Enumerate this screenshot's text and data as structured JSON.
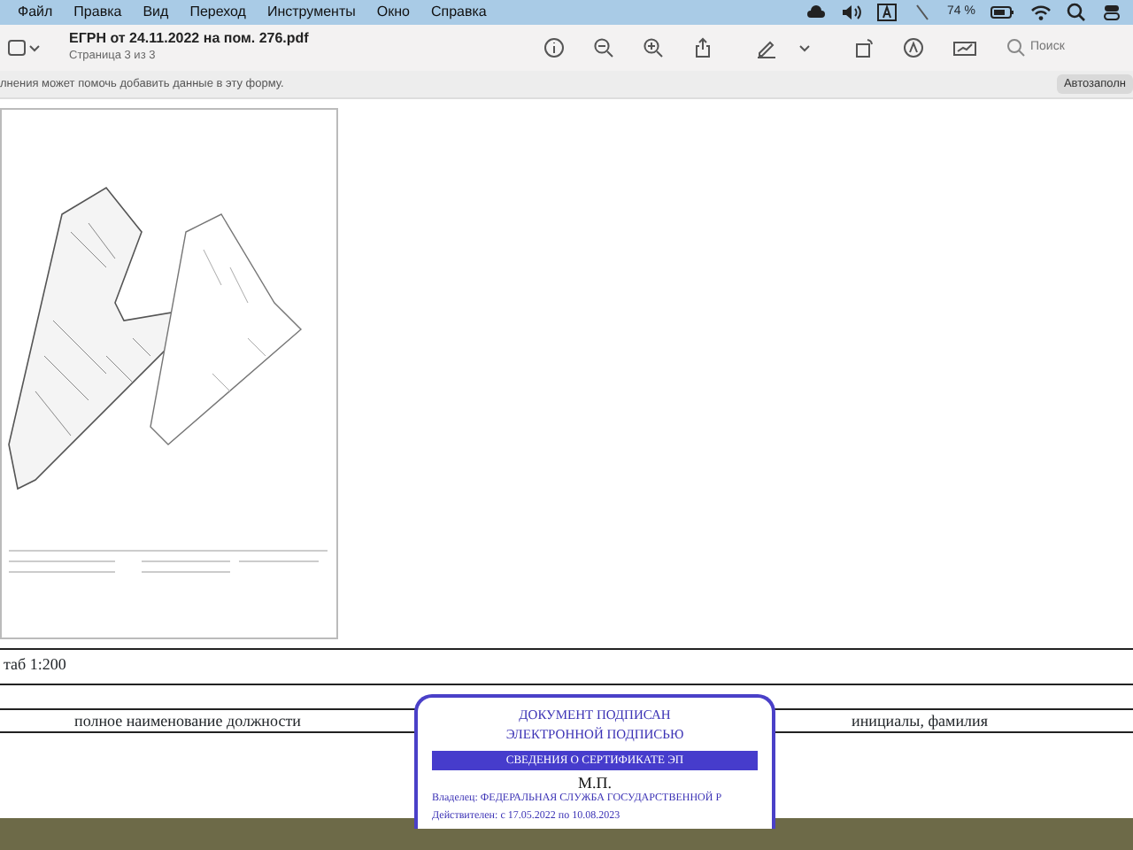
{
  "menu_bar": {
    "items": [
      "Файл",
      "Правка",
      "Вид",
      "Переход",
      "Инструменты",
      "Окно",
      "Справка"
    ],
    "battery_text": "74 %"
  },
  "toolbar": {
    "title": "ЕГРН от 24.11.2022 на пом. 276.pdf",
    "subtitle": "Страница 3 из 3",
    "search": {
      "placeholder": "Поиск"
    }
  },
  "autofill_bar": {
    "message": "лнения может помочь добавить данные в эту форму.",
    "button": "Автозаполн"
  },
  "document": {
    "scale_text": "таб 1:200",
    "position_label": "полное наименование должности",
    "name_label": "инициалы, фамилия",
    "stamp": {
      "line_1": "ДОКУМЕНТ ПОДПИСАН",
      "line_2": "ЭЛЕКТРОННОЙ ПОДПИСЬЮ",
      "header": "СВЕДЕНИЯ О СЕРТИФИКАТЕ ЭП",
      "seal": "М.П.",
      "owner": "Владелец: ФЕДЕРАЛЬНАЯ СЛУЖБА ГОСУДАРСТВЕННОЙ Р",
      "validity": "Действителен: с 17.05.2022 по 10.08.2023"
    }
  }
}
